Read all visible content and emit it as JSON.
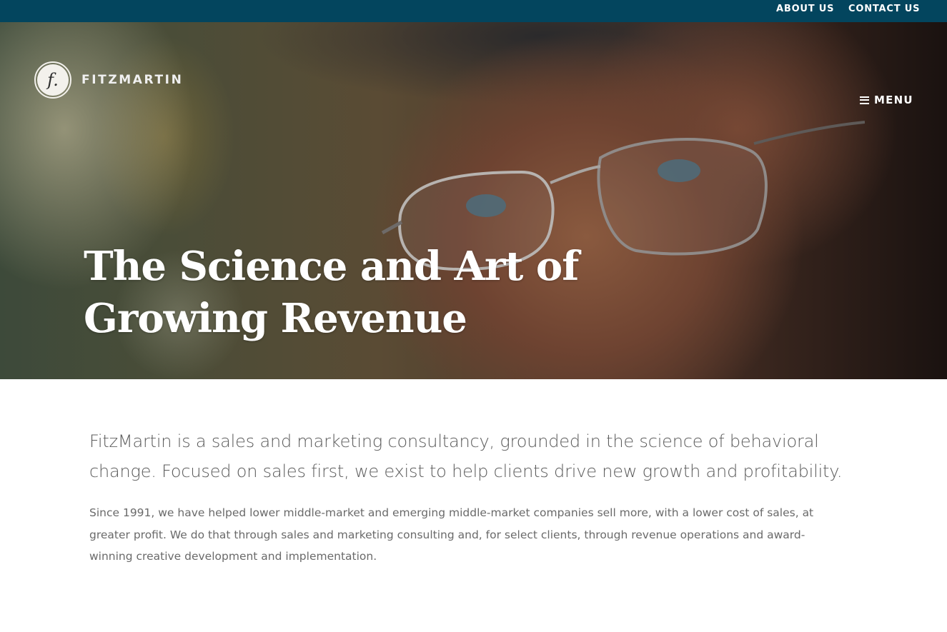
{
  "topbar": {
    "about_label": "ABOUT US",
    "contact_label": "CONTACT US",
    "background": "#03455e"
  },
  "logo": {
    "mark": "f.",
    "name": "FITZMARTIN"
  },
  "menu": {
    "icon": "hamburger-icon",
    "label": "MENU"
  },
  "hero": {
    "title": "The Science and Art of Growing Revenue",
    "image": "portrait of older man with glasses and cap"
  },
  "intro": {
    "lead": "FitzMartin is a sales and marketing consultancy, grounded in the science of behavioral change. Focused on sales first, we exist to help clients drive new growth and profitability.",
    "body": "Since 1991, we have helped lower middle-market and emerging middle-market companies sell more, with a lower cost of sales, at greater profit. We do that through sales and marketing consulting and, for select clients, through revenue operations and award-winning creative development and implementation."
  }
}
